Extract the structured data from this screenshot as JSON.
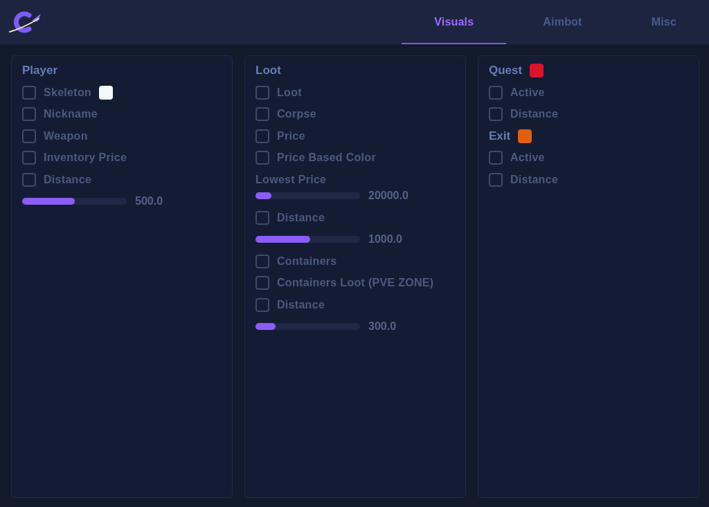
{
  "header": {
    "tabs": [
      {
        "label": "Visuals",
        "selected": true
      },
      {
        "label": "Aimbot",
        "selected": false
      },
      {
        "label": "Misc",
        "selected": false
      }
    ]
  },
  "panels": [
    {
      "items": [
        {
          "kind": "heading",
          "label": "Player"
        },
        {
          "kind": "checkbox",
          "label": "Skeleton",
          "checked": false,
          "color": "#f4f8fc"
        },
        {
          "kind": "checkbox",
          "label": "Nickname",
          "checked": false
        },
        {
          "kind": "checkbox",
          "label": "Weapon",
          "checked": false
        },
        {
          "kind": "checkbox",
          "label": "Inventory Price",
          "checked": false
        },
        {
          "kind": "checkbox",
          "label": "Distance",
          "checked": false
        },
        {
          "kind": "slider",
          "level": 0.5,
          "reading": "500.0"
        }
      ]
    },
    {
      "items": [
        {
          "kind": "heading",
          "label": "Loot"
        },
        {
          "kind": "checkbox",
          "label": "Loot",
          "checked": false
        },
        {
          "kind": "checkbox",
          "label": "Corpse",
          "checked": false
        },
        {
          "kind": "checkbox",
          "label": "Price",
          "checked": false
        },
        {
          "kind": "checkbox",
          "label": "Price Based Color",
          "checked": false
        },
        {
          "kind": "label",
          "label": "Lowest Price"
        },
        {
          "kind": "slider",
          "level": 0.15,
          "reading": "20000.0"
        },
        {
          "kind": "checkbox",
          "label": "Distance",
          "checked": false
        },
        {
          "kind": "slider",
          "level": 0.52,
          "reading": "1000.0"
        },
        {
          "kind": "checkbox",
          "label": "Containers",
          "checked": false
        },
        {
          "kind": "checkbox",
          "label": "Containers Loot (PVE ZONE)",
          "checked": false
        },
        {
          "kind": "checkbox",
          "label": "Distance",
          "checked": false
        },
        {
          "kind": "slider",
          "level": 0.19,
          "reading": "300.0"
        }
      ]
    },
    {
      "items": [
        {
          "kind": "heading",
          "label": "Quest",
          "color": "#d9142c"
        },
        {
          "kind": "checkbox",
          "label": "Active",
          "checked": false
        },
        {
          "kind": "checkbox",
          "label": "Distance",
          "checked": false
        },
        {
          "kind": "heading",
          "label": "Exit",
          "color": "#e0600f"
        },
        {
          "kind": "checkbox",
          "label": "Active",
          "checked": false
        },
        {
          "kind": "checkbox",
          "label": "Distance",
          "checked": false
        }
      ]
    }
  ]
}
